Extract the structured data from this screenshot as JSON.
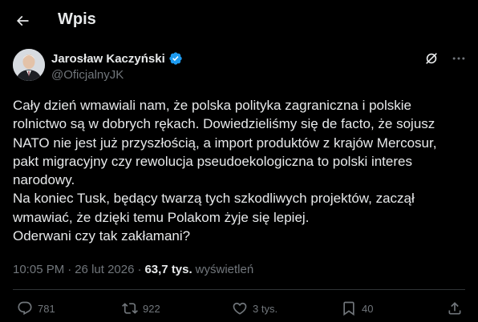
{
  "header": {
    "title": "Wpis",
    "back_icon": "arrow-left-icon"
  },
  "author": {
    "name": "Jarosław Kaczyński",
    "handle": "@OficjalnyJK",
    "verified_color": "#1d9bf0"
  },
  "tweet": {
    "text": "Cały dzień wmawiali nam, że polska polityka zagraniczna i polskie\nrolnictwo są w dobrych rękach. Dowiedzieliśmy się de facto, że sojusz\nNATO nie jest już przyszłością, a import produktów z krajów Mercosur,\npakt migracyjny czy rewolucja pseudoekologiczna to polski interes\nnarodowy.\nNa koniec Tusk, będący twarzą tych szkodliwych projektów, zaczął\nwmawiać, że dzięki temu Polakom żyje się lepiej.\nOderwani czy tak zakłamani?"
  },
  "meta": {
    "time": "10:05 PM",
    "separator": "·",
    "date": "26 lut 2026",
    "views_count": "63,7 tys.",
    "views_label": "wyświetleń"
  },
  "actions": {
    "replies": "781",
    "reposts": "922",
    "likes": "3 tys.",
    "bookmarks": "40"
  },
  "colors": {
    "background": "#000000",
    "text": "#e7e9ea",
    "muted": "#71767b",
    "divider": "#2f3336"
  }
}
